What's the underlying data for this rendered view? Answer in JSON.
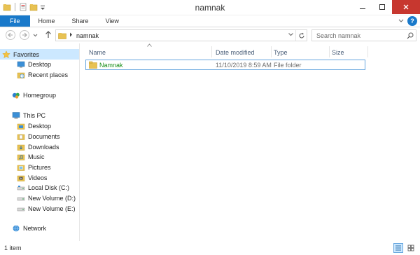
{
  "window": {
    "title": "namnak"
  },
  "ribbon": {
    "tabs": [
      {
        "label": "File"
      },
      {
        "label": "Home"
      },
      {
        "label": "Share"
      },
      {
        "label": "View"
      }
    ],
    "help_label": "?"
  },
  "addressbar": {
    "path": "namnak",
    "search_placeholder": "Search namnak"
  },
  "navpane": {
    "favorites": {
      "label": "Favorites",
      "icon": "star-icon"
    },
    "favorites_items": [
      {
        "label": "Desktop",
        "icon": "desktop-icon"
      },
      {
        "label": "Recent places",
        "icon": "recent-places-icon"
      }
    ],
    "homegroup": {
      "label": "Homegroup",
      "icon": "homegroup-icon"
    },
    "thispc": {
      "label": "This PC",
      "icon": "computer-icon"
    },
    "thispc_items": [
      {
        "label": "Desktop",
        "icon": "desktop-icon"
      },
      {
        "label": "Documents",
        "icon": "documents-icon"
      },
      {
        "label": "Downloads",
        "icon": "downloads-icon"
      },
      {
        "label": "Music",
        "icon": "music-icon"
      },
      {
        "label": "Pictures",
        "icon": "pictures-icon"
      },
      {
        "label": "Videos",
        "icon": "videos-icon"
      },
      {
        "label": "Local Disk (C:)",
        "icon": "drive-icon"
      },
      {
        "label": "New Volume (D:)",
        "icon": "drive-icon"
      },
      {
        "label": "New Volume (E:)",
        "icon": "drive-icon"
      }
    ],
    "network": {
      "label": "Network",
      "icon": "network-icon"
    }
  },
  "filelist": {
    "columns": [
      {
        "label": "Name"
      },
      {
        "label": "Date modified"
      },
      {
        "label": "Type"
      },
      {
        "label": "Size"
      }
    ],
    "rows": [
      {
        "name": "Namnak",
        "date_modified": "11/10/2019 8:59 AM",
        "type": "File folder",
        "size": ""
      }
    ]
  },
  "statusbar": {
    "item_count": "1 item"
  },
  "colors": {
    "accent": "#1979ca",
    "selection": "#cce8ff",
    "selection_border": "#66a6df",
    "close_button": "#c7372f",
    "folder": "#e8c253",
    "compressed_name": "#1a8f1a"
  }
}
